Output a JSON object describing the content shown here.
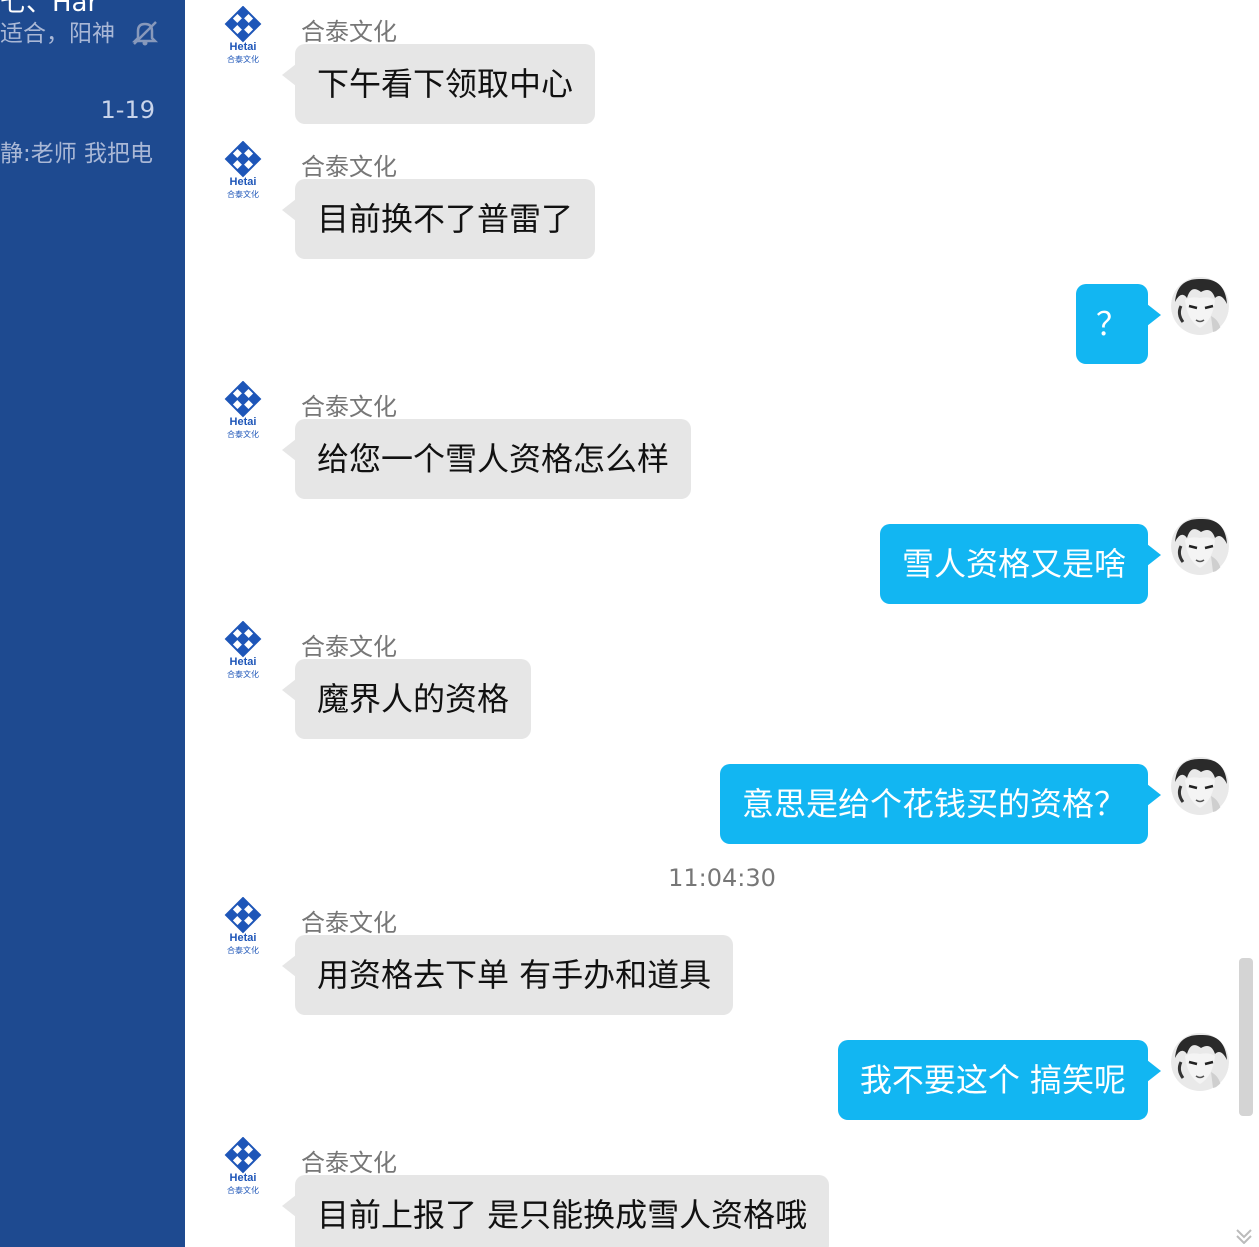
{
  "sidebar": {
    "title_fragment": "七、Har",
    "snippet1": "适合，阳神",
    "date": "1-19",
    "snippet2": "静:老师 我把电"
  },
  "chat": {
    "sender_name": "合泰文化",
    "logo_text": "Hetai",
    "logo_sub": "合泰文化",
    "timestamp": "11:04:30",
    "messages": [
      {
        "dir": "in",
        "text": "下午看下领取中心"
      },
      {
        "dir": "in",
        "text": "目前换不了普雷了"
      },
      {
        "dir": "out",
        "text": "？"
      },
      {
        "dir": "in",
        "text": "给您一个雪人资格怎么样"
      },
      {
        "dir": "out",
        "text": "雪人资格又是啥"
      },
      {
        "dir": "in",
        "text": "魔界人的资格"
      },
      {
        "dir": "out",
        "text": "意思是给个花钱买的资格？"
      },
      {
        "dir": "in",
        "text": "用资格去下单  有手办和道具"
      },
      {
        "dir": "out",
        "text": "我不要这个 搞笑呢"
      },
      {
        "dir": "in",
        "text": "目前上报了  是只能换成雪人资格哦"
      }
    ]
  },
  "colors": {
    "sidebar_bg": "#1e4a90",
    "incoming_bubble": "#e6e6e6",
    "outgoing_bubble": "#12b6f2"
  },
  "icons": {
    "mute": "bell-slash-icon",
    "logo": "hetai-logo-icon",
    "user_avatar": "user-avatar-icon"
  }
}
